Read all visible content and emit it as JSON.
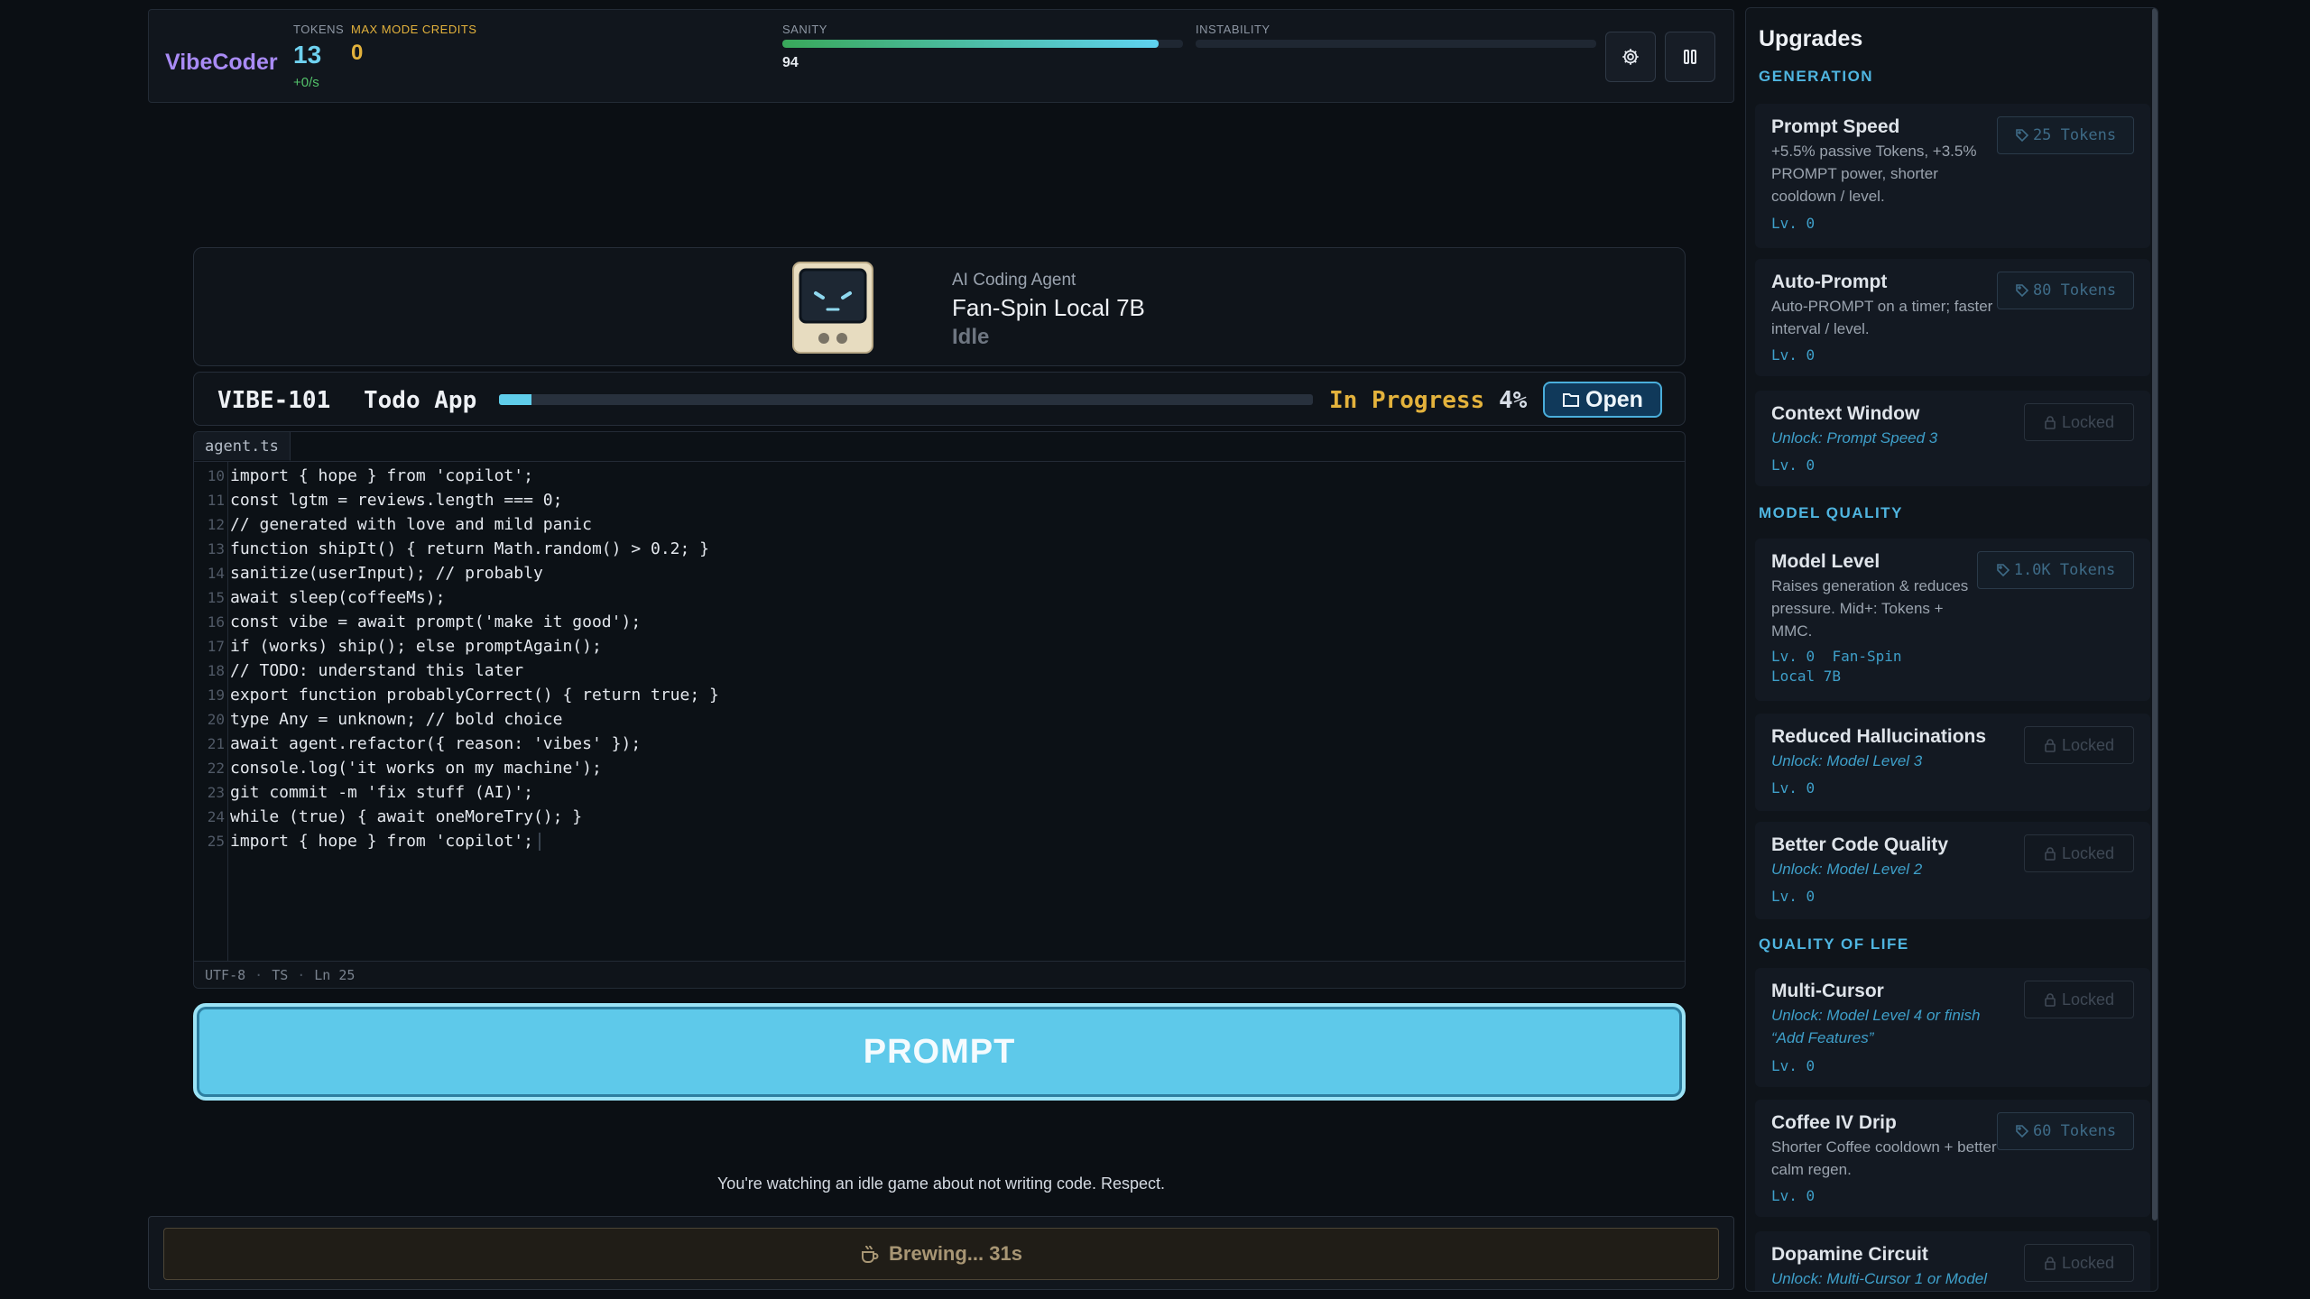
{
  "topbar": {
    "brand": "VibeCoder",
    "tokens_label": "TOKENS",
    "tokens_value": "13",
    "tokens_rate": "+0/s",
    "mmc_label": "MAX MODE CREDITS",
    "mmc_value": "0",
    "sanity_label": "SANITY",
    "sanity_value": "94",
    "sanity_level": 94,
    "instability_label": "INSTABILITY",
    "instability_level": 0,
    "settings_icon": "gear-icon",
    "pause_icon": "pause-icon"
  },
  "agent": {
    "role": "AI Coding Agent",
    "name": "Fan-Spin Local 7B",
    "status": "Idle"
  },
  "ticket": {
    "id": "VIBE-101",
    "title": "Todo App",
    "status": "In Progress",
    "progress_label": "4%",
    "progress": 4,
    "open_label": "Open"
  },
  "editor": {
    "tab": "agent.ts",
    "lines": [
      {
        "n": "10",
        "code": "import { hope } from 'copilot';"
      },
      {
        "n": "11",
        "code": "const lgtm = reviews.length === 0;"
      },
      {
        "n": "12",
        "code": "// generated with love and mild panic"
      },
      {
        "n": "13",
        "code": "function shipIt() { return Math.random() > 0.2; }"
      },
      {
        "n": "14",
        "code": "sanitize(userInput); // probably"
      },
      {
        "n": "15",
        "code": "await sleep(coffeeMs);"
      },
      {
        "n": "16",
        "code": "const vibe = await prompt('make it good');"
      },
      {
        "n": "17",
        "code": "if (works) ship(); else promptAgain();"
      },
      {
        "n": "18",
        "code": "// TODO: understand this later"
      },
      {
        "n": "19",
        "code": "export function probablyCorrect() { return true; }"
      },
      {
        "n": "20",
        "code": "type Any = unknown; // bold choice"
      },
      {
        "n": "21",
        "code": "await agent.refactor({ reason: 'vibes' });"
      },
      {
        "n": "22",
        "code": "console.log('it works on my machine');"
      },
      {
        "n": "23",
        "code": "git commit -m 'fix stuff (AI)';"
      },
      {
        "n": "24",
        "code": "while (true) { await oneMoreTry(); }"
      },
      {
        "n": "25",
        "code": "import { hope } from 'copilot';"
      }
    ],
    "status_encoding": "UTF-8",
    "status_lang": "TS",
    "status_line": "Ln 25",
    "status_sep": "·"
  },
  "prompt_label": "PROMPT",
  "tagline": "You're watching an idle game about not writing code. Respect.",
  "coffee": {
    "label": "Brewing... 31s",
    "icon": "coffee-icon"
  },
  "upgrades": {
    "title": "Upgrades",
    "sections": {
      "generation": "GENERATION",
      "model_quality": "MODEL QUALITY",
      "quality_of_life": "QUALITY OF LIFE"
    },
    "locked_label": "Locked",
    "prompt_speed": {
      "name": "Prompt Speed",
      "desc": "+5.5% passive Tokens, +3.5% PROMPT power, shorter cooldown / level.",
      "price": "25 Tokens",
      "level": "Lv. 0"
    },
    "auto_prompt": {
      "name": "Auto-Prompt",
      "desc": "Auto-PROMPT on a timer; faster interval / level.",
      "price": "80 Tokens",
      "level": "Lv. 0"
    },
    "context_window": {
      "name": "Context Window",
      "unlock": "Unlock: Prompt Speed 3",
      "level": "Lv. 0"
    },
    "model_level": {
      "name": "Model Level",
      "desc": "Raises generation & reduces pressure. Mid+: Tokens + MMC.",
      "price": "1.0K Tokens",
      "level": "Lv. 0",
      "model": "Fan-Spin Local 7B"
    },
    "reduced_hallucinations": {
      "name": "Reduced Hallucinations",
      "unlock": "Unlock: Model Level 3",
      "level": "Lv. 0"
    },
    "better_code_quality": {
      "name": "Better Code Quality",
      "unlock": "Unlock: Model Level 2",
      "level": "Lv. 0"
    },
    "multi_cursor": {
      "name": "Multi-Cursor",
      "unlock": "Unlock: Model Level 4 or finish “Add Features”",
      "level": "Lv. 0"
    },
    "coffee_iv_drip": {
      "name": "Coffee IV Drip",
      "desc": "Shorter Coffee cooldown + better calm regen.",
      "price": "60 Tokens",
      "level": "Lv. 0"
    },
    "dopamine_circuit": {
      "name": "Dopamine Circuit",
      "unlock": "Unlock: Multi-Cursor 1 or Model"
    }
  }
}
